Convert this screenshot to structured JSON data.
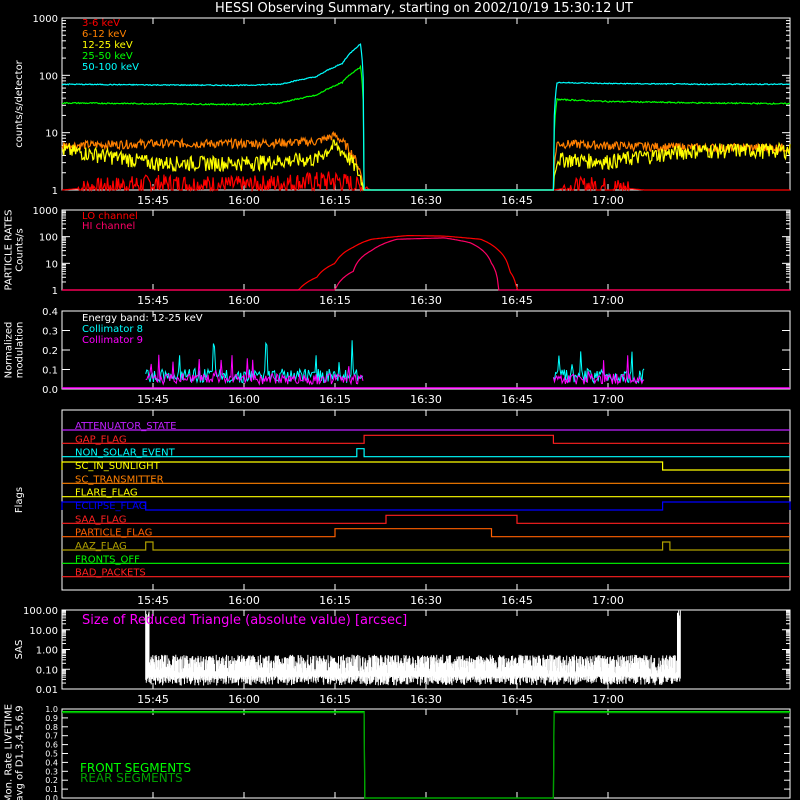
{
  "page_title": "HESSI Observing Summary, starting on 2002/10/19 15:30:12 UT",
  "time_axis": {
    "ticks": [
      "15:45",
      "16:00",
      "16:15",
      "16:30",
      "16:45",
      "17:00"
    ]
  },
  "chart_data": [
    {
      "type": "line",
      "ylabel": "counts/s/detector",
      "yscale": "log",
      "ylim": [
        1,
        1000
      ],
      "yticks": [
        "1",
        "10",
        "100",
        "1000"
      ],
      "legend": [
        "3-6 keV",
        "6-12 keV",
        "12-25 keV",
        "25-50 keV",
        "50-100 keV"
      ],
      "legend_placement": "top-left",
      "series": [
        {
          "name": "3-6 keV",
          "color": "#ff0000",
          "data": [
            [
              15.5,
              1.0
            ],
            [
              15.75,
              1.3
            ],
            [
              16.0,
              1.2
            ],
            [
              16.25,
              1.5
            ],
            [
              16.35,
              1.0
            ],
            [
              16.85,
              1.0
            ],
            [
              16.95,
              1.2
            ],
            [
              17.1,
              1.0
            ],
            [
              17.5,
              1.0
            ]
          ]
        },
        {
          "name": "6-12 keV",
          "color": "#ff8000",
          "data": [
            [
              15.5,
              6.0
            ],
            [
              15.75,
              6.5
            ],
            [
              16.0,
              6.5
            ],
            [
              16.2,
              7.0
            ],
            [
              16.25,
              9.0
            ],
            [
              16.33,
              1.0
            ],
            [
              16.85,
              1.0
            ],
            [
              16.86,
              6.5
            ],
            [
              17.0,
              6.0
            ],
            [
              17.25,
              5.5
            ],
            [
              17.5,
              5.5
            ]
          ]
        },
        {
          "name": "12-25 keV",
          "color": "#ffff00",
          "data": [
            [
              15.5,
              5.0
            ],
            [
              15.75,
              3.0
            ],
            [
              16.0,
              3.0
            ],
            [
              16.2,
              3.5
            ],
            [
              16.25,
              6.0
            ],
            [
              16.33,
              1.0
            ],
            [
              16.85,
              1.0
            ],
            [
              16.86,
              3.5
            ],
            [
              17.0,
              3.2
            ],
            [
              17.25,
              5.0
            ],
            [
              17.5,
              5.0
            ]
          ]
        },
        {
          "name": "25-50 keV",
          "color": "#00ff00",
          "data": [
            [
              15.5,
              33
            ],
            [
              15.75,
              32
            ],
            [
              16.0,
              31
            ],
            [
              16.1,
              33
            ],
            [
              16.2,
              45
            ],
            [
              16.27,
              75
            ],
            [
              16.32,
              140
            ],
            [
              16.33,
              1.0
            ],
            [
              16.85,
              1.0
            ],
            [
              16.86,
              38
            ],
            [
              17.0,
              35
            ],
            [
              17.25,
              33
            ],
            [
              17.5,
              32
            ]
          ]
        },
        {
          "name": "50-100 keV",
          "color": "#00ffff",
          "data": [
            [
              15.5,
              70
            ],
            [
              15.75,
              68
            ],
            [
              16.0,
              67
            ],
            [
              16.1,
              70
            ],
            [
              16.2,
              95
            ],
            [
              16.27,
              160
            ],
            [
              16.32,
              350
            ],
            [
              16.33,
              1.0
            ],
            [
              16.85,
              1.0
            ],
            [
              16.86,
              75
            ],
            [
              17.0,
              72
            ],
            [
              17.25,
              70
            ],
            [
              17.5,
              70
            ]
          ]
        }
      ]
    },
    {
      "type": "line",
      "ylabel": "PARTICLE RATES\nCounts/s",
      "yscale": "log",
      "ylim": [
        1,
        1000
      ],
      "yticks": [
        "1",
        "10",
        "100",
        "1000"
      ],
      "legend": [
        "LO channel",
        "HI channel"
      ],
      "series": [
        {
          "name": "LO channel",
          "color": "#ff0000",
          "data": [
            [
              15.5,
              1.0
            ],
            [
              16.15,
              1.0
            ],
            [
              16.2,
              3.0
            ],
            [
              16.25,
              10
            ],
            [
              16.3,
              40
            ],
            [
              16.35,
              80
            ],
            [
              16.45,
              110
            ],
            [
              16.55,
              105
            ],
            [
              16.65,
              80
            ],
            [
              16.7,
              30
            ],
            [
              16.73,
              5
            ],
            [
              16.75,
              1.0
            ],
            [
              17.5,
              1.0
            ]
          ]
        },
        {
          "name": "HI channel",
          "color": "#ff0066",
          "data": [
            [
              15.5,
              1.0
            ],
            [
              16.25,
              1.0
            ],
            [
              16.3,
              5.0
            ],
            [
              16.35,
              30
            ],
            [
              16.42,
              80
            ],
            [
              16.55,
              90
            ],
            [
              16.62,
              60
            ],
            [
              16.68,
              10
            ],
            [
              16.7,
              1.0
            ],
            [
              17.5,
              1.0
            ]
          ]
        }
      ]
    },
    {
      "type": "line",
      "ylabel": "Normalized\nmodulation",
      "ylim": [
        0.0,
        0.4
      ],
      "yticks": [
        "0.0",
        "0.1",
        "0.2",
        "0.3",
        "0.4"
      ],
      "legend": [
        "Energy band: 12-25 keV",
        "Collimator 8",
        "Collimator 9"
      ],
      "series": [
        {
          "name": "Collimator 8",
          "color": "#00ffff",
          "segments": [
            [
              15.73,
              16.33
            ],
            [
              16.85,
              17.1
            ]
          ],
          "typical": 0.08,
          "peak": 0.26
        },
        {
          "name": "Collimator 9",
          "color": "#ff00ff",
          "segments": [
            [
              15.73,
              16.33
            ],
            [
              16.85,
              17.1
            ]
          ],
          "typical": 0.06,
          "peak": 0.22
        }
      ]
    },
    {
      "type": "line",
      "ylabel": "Flags",
      "flags": [
        {
          "name": "ATTENUATOR_STATE",
          "color": "#c020ff",
          "on": []
        },
        {
          "name": "GAP_FLAG",
          "color": "#ff2020",
          "on": [
            [
              16.33,
              16.85
            ]
          ]
        },
        {
          "name": "NON_SOLAR_EVENT",
          "color": "#00ffff",
          "on": [
            [
              16.31,
              16.33
            ]
          ]
        },
        {
          "name": "SC_IN_SUNLIGHT",
          "color": "#ffff00",
          "on": [
            [
              15.5,
              17.15
            ]
          ]
        },
        {
          "name": "SC_TRANSMITTER",
          "color": "#ff8000",
          "on": []
        },
        {
          "name": "FLARE_FLAG",
          "color": "#ffff00",
          "on": []
        },
        {
          "name": "ECLIPSE_FLAG",
          "color": "#0000ff",
          "on": [
            [
              15.5,
              15.73
            ],
            [
              17.15,
              17.5
            ]
          ]
        },
        {
          "name": "SAA_FLAG",
          "color": "#ff2020",
          "on": [
            [
              16.39,
              16.75
            ]
          ]
        },
        {
          "name": "PARTICLE_FLAG",
          "color": "#ff6000",
          "on": [
            [
              16.25,
              16.68
            ]
          ]
        },
        {
          "name": "AAZ_FLAG",
          "color": "#b0a000",
          "on": [
            [
              15.73,
              15.75
            ],
            [
              17.15,
              17.17
            ]
          ]
        },
        {
          "name": "FRONTS_OFF",
          "color": "#00ff00",
          "on": []
        },
        {
          "name": "BAD_PACKETS",
          "color": "#ff2020",
          "on": []
        }
      ]
    },
    {
      "type": "line",
      "ylabel": "SAS",
      "title": "Size of Reduced Triangle (absolute value) [arcsec]",
      "yscale": "log",
      "ylim": [
        0.01,
        100
      ],
      "yticks": [
        "0.01",
        "0.10",
        "1.00",
        "10.00",
        "100.00"
      ],
      "series": [
        {
          "name": "",
          "color": "#ffffff",
          "segments": [
            [
              15.73,
              17.2
            ]
          ],
          "start_value": 100,
          "plateau_value": 0.3,
          "floor_value": 0.03,
          "end_value": 100
        }
      ]
    },
    {
      "type": "line",
      "ylabel": "Mon. Rate LIVETIME\navg of D1,3,4,5,6,9",
      "ylim": [
        0.0,
        1.0
      ],
      "yticks": [
        "0.0",
        "0.1",
        "0.2",
        "0.3",
        "0.4",
        "0.5",
        "0.6",
        "0.7",
        "0.8",
        "0.9",
        "1.0"
      ],
      "legend": [
        "FRONT SEGMENTS",
        "REAR SEGMENTS"
      ],
      "series": [
        {
          "name": "FRONT SEGMENTS",
          "color": "#00ff00",
          "data": [
            [
              15.5,
              0.97
            ],
            [
              16.33,
              0.97
            ],
            [
              16.33,
              0.0
            ],
            [
              16.85,
              0.0
            ],
            [
              16.85,
              0.97
            ],
            [
              17.5,
              0.97
            ]
          ]
        },
        {
          "name": "REAR SEGMENTS",
          "color": "#00a000",
          "data": [
            [
              15.5,
              0.96
            ],
            [
              16.33,
              0.96
            ],
            [
              16.33,
              0.0
            ],
            [
              16.85,
              0.0
            ],
            [
              16.85,
              0.96
            ],
            [
              17.5,
              0.96
            ]
          ]
        }
      ]
    }
  ]
}
